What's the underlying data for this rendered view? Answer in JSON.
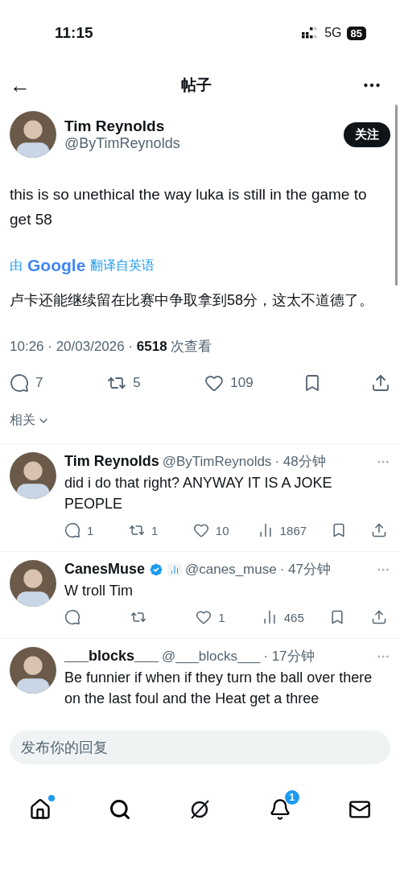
{
  "status_bar": {
    "time": "11:15",
    "network": "5G",
    "battery": "85"
  },
  "header": {
    "back": "←",
    "title": "帖子"
  },
  "post": {
    "author": "Tim Reynolds",
    "handle": "@ByTimReynolds",
    "follow": "关注",
    "text": "this is so unethical the way luka is still in the game to get 58",
    "translation": {
      "by": "由",
      "brand": "Google",
      "label": "翻译自英语",
      "text": "卢卡还能继续留在比赛中争取拿到58分，这太不道德了。"
    },
    "time": "10:26 · 20/03/2026 · ",
    "views": "6518",
    "views_label": " 次查看",
    "actions": [
      {
        "kind": "reply",
        "count": "7"
      },
      {
        "kind": "repost",
        "count": "5"
      },
      {
        "kind": "like",
        "count": "109"
      },
      {
        "kind": "bookmark"
      },
      {
        "kind": "share"
      }
    ]
  },
  "related": "相关",
  "replies": [
    {
      "name": "Tim Reynolds",
      "verified": false,
      "handle": "@ByTimReynolds",
      "time": "· 48分钟",
      "text": "did i do that right? ANYWAY IT IS A JOKE PEOPLE",
      "actions": [
        {
          "kind": "reply",
          "count": "1"
        },
        {
          "kind": "repost",
          "count": "1"
        },
        {
          "kind": "like",
          "count": "10"
        },
        {
          "kind": "views",
          "count": "1867"
        },
        {
          "kind": "bookmark"
        },
        {
          "kind": "share"
        }
      ]
    },
    {
      "name": "CanesMuse",
      "verified": true,
      "handle": "@canes_muse",
      "time": "· 47分钟",
      "text": "W troll Tim",
      "actions": [
        {
          "kind": "reply"
        },
        {
          "kind": "repost"
        },
        {
          "kind": "like",
          "count": "1"
        },
        {
          "kind": "views",
          "count": "465"
        },
        {
          "kind": "bookmark"
        },
        {
          "kind": "share"
        }
      ]
    },
    {
      "name": "___blocks___",
      "verified": false,
      "handle": "@___blocks___",
      "time": "· 17分钟",
      "text": "Be funnier if when if they turn the ball over there on the last foul and the Heat get a three"
    }
  ],
  "reply_field": {
    "placeholder": "发布你的回复"
  },
  "nav": [
    {
      "kind": "home",
      "dot": true
    },
    {
      "kind": "search",
      "dot": false
    },
    {
      "kind": "grok",
      "dot": false
    },
    {
      "kind": "bell",
      "dot": false,
      "badge": "1"
    },
    {
      "kind": "mail",
      "dot": false
    }
  ]
}
